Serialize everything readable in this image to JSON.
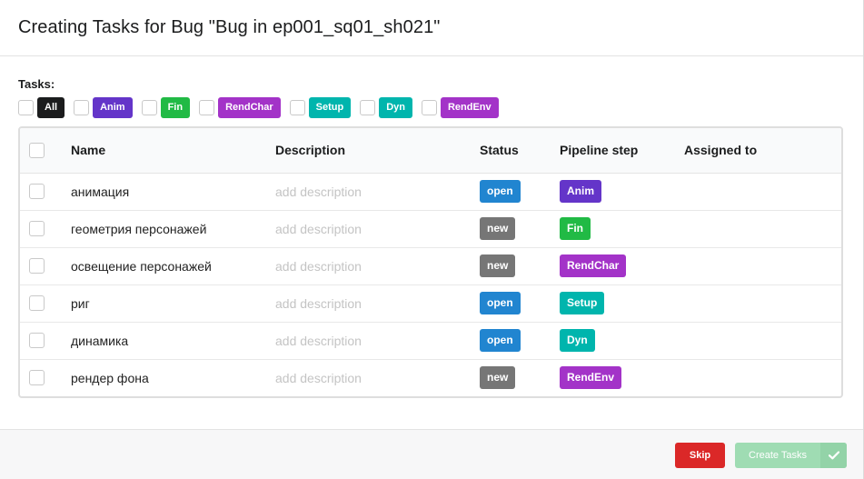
{
  "dialog": {
    "title": "Creating Tasks for Bug \"Bug in ep001_sq01_sh021\""
  },
  "filters": {
    "label": "Tasks:",
    "items": [
      {
        "label": "All",
        "color": "#1b1c1d"
      },
      {
        "label": "Anim",
        "color": "#6435c9"
      },
      {
        "label": "Fin",
        "color": "#21ba45"
      },
      {
        "label": "RendChar",
        "color": "#a333c8"
      },
      {
        "label": "Setup",
        "color": "#00b5ad"
      },
      {
        "label": "Dyn",
        "color": "#00b5ad"
      },
      {
        "label": "RendEnv",
        "color": "#a333c8"
      }
    ]
  },
  "table": {
    "columns": [
      "Name",
      "Description",
      "Status",
      "Pipeline step",
      "Assigned to"
    ],
    "rows": [
      {
        "name": "анимация",
        "description": "add description",
        "status": "open",
        "status_color": "#2185d0",
        "step": "Anim",
        "step_color": "#6435c9"
      },
      {
        "name": "геометрия персонажей",
        "description": "add description",
        "status": "new",
        "status_color": "#767676",
        "step": "Fin",
        "step_color": "#21ba45"
      },
      {
        "name": "освещение персонажей",
        "description": "add description",
        "status": "new",
        "status_color": "#767676",
        "step": "RendChar",
        "step_color": "#a333c8"
      },
      {
        "name": "риг",
        "description": "add description",
        "status": "open",
        "status_color": "#2185d0",
        "step": "Setup",
        "step_color": "#00b5ad"
      },
      {
        "name": "динамика",
        "description": "add description",
        "status": "open",
        "status_color": "#2185d0",
        "step": "Dyn",
        "step_color": "#00b5ad"
      },
      {
        "name": "рендер фона",
        "description": "add description",
        "status": "new",
        "status_color": "#767676",
        "step": "RendEnv",
        "step_color": "#a333c8"
      }
    ]
  },
  "footer": {
    "skip_label": "Skip",
    "create_label": "Create Tasks",
    "create_icon": "checkmark-icon"
  }
}
